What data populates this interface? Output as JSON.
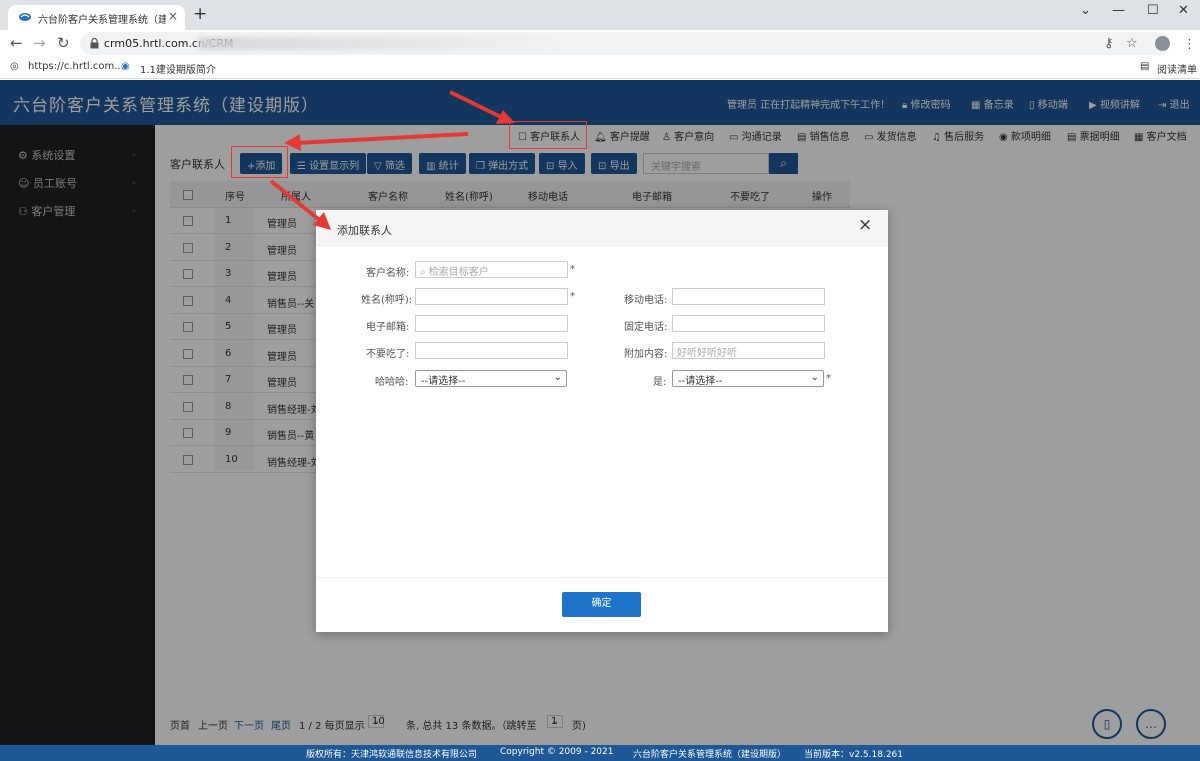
{
  "browser": {
    "tab_title": "六台阶客户关系管理系统（建设期版）",
    "tab_close": "×",
    "new_tab": "+",
    "url": "crm05.hrtl.com.cn/CRM",
    "bookmarks": [
      {
        "label": "https://c.hrtl.com...."
      },
      {
        "label": "1.1建设期版简介"
      }
    ],
    "reading_list": "阅读清单"
  },
  "app": {
    "title": "六台阶客户关系管理系统（建设期版）",
    "status": "管理员 正在打起精神完成下午工作！",
    "header_links": [
      "修改密码",
      "备忘录",
      "移动端",
      "视频讲解",
      "退出"
    ],
    "brand_color": "#1e5896"
  },
  "sidebar": {
    "items": [
      {
        "label": "系统设置"
      },
      {
        "label": "员工账号"
      },
      {
        "label": "客户管理"
      }
    ]
  },
  "subnav": {
    "items": [
      "客户联系人",
      "客户提醒",
      "客户意向",
      "沟通记录",
      "销售信息",
      "发货信息",
      "售后服务",
      "款项明细",
      "票据明细",
      "客户文档"
    ]
  },
  "list": {
    "page_label": "客户联系人",
    "buttons": [
      "+添加",
      "设置显示列",
      "筛选",
      "统计",
      "弹出方式",
      "导入",
      "导出"
    ],
    "search_placeholder": "关键字搜索",
    "columns": [
      "序号",
      "所属人",
      "客户名称",
      "姓名(称呼)",
      "移动电话",
      "电子邮箱",
      "不要吃了",
      "操作"
    ],
    "rows": [
      {
        "seq": "1",
        "owner": "管理员"
      },
      {
        "seq": "2",
        "owner": "管理员"
      },
      {
        "seq": "3",
        "owner": "管理员"
      },
      {
        "seq": "4",
        "owner": "销售员--关"
      },
      {
        "seq": "5",
        "owner": "管理员"
      },
      {
        "seq": "6",
        "owner": "管理员"
      },
      {
        "seq": "7",
        "owner": "管理员"
      },
      {
        "seq": "8",
        "owner": "销售经理-刘"
      },
      {
        "seq": "9",
        "owner": "销售员--黄"
      },
      {
        "seq": "10",
        "owner": "销售经理-刘"
      }
    ]
  },
  "pager": {
    "first": "页首",
    "prev": "上一页",
    "next": "下一页",
    "last": "尾页",
    "page_info": "1 / 2  每页显示",
    "page_size": "10",
    "summary": "条, 总共 13 条数据。（跳转至",
    "jump_page": "1",
    "suffix": "页)"
  },
  "modal": {
    "title": "添加联系人",
    "close": "×",
    "fields": {
      "customer_name_label": "客户名称:",
      "customer_name_placeholder": "检索目标客户",
      "name_label": "姓名(称呼):",
      "mobile_label": "移动电话:",
      "email_label": "电子邮箱:",
      "phone_label": "固定电话:",
      "noeat_label": "不要吃了:",
      "extra_label": "附加内容:",
      "extra_placeholder": "好听好听好听",
      "hahaha_label": "哈哈哈:",
      "hahaha_value": "--请选择--",
      "shi_label": "是:",
      "shi_value": "--请选择--",
      "required_mark": "*"
    },
    "confirm": "确定"
  },
  "footer": {
    "copyright_owner": "版权所有：天津鸿软通联信息技术有限公司",
    "copyright": "Copyright © 2009 - 2021",
    "system": "六台阶客户关系管理系统（建设期版）",
    "version": "当前版本：v2.5.18.261"
  }
}
